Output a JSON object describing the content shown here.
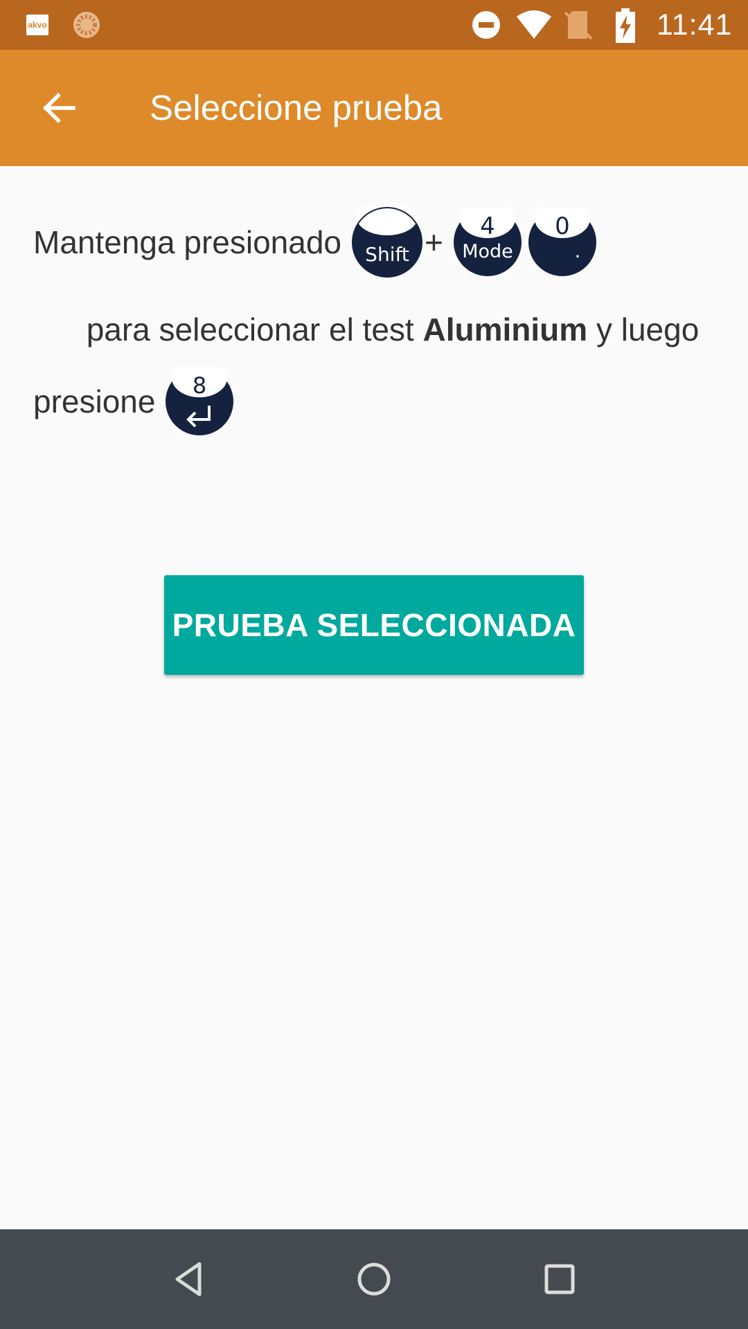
{
  "status_bar": {
    "app_icon_text": "akvo",
    "time": "11:41",
    "icons": [
      "akvo-app-icon",
      "sync-icon",
      "do-not-disturb-icon",
      "wifi-icon",
      "no-sim-icon",
      "battery-charging-icon"
    ]
  },
  "app_bar": {
    "back_icon": "arrow-left-icon",
    "title": "Seleccione prueba",
    "background_color": "#de8a2a"
  },
  "instructions": {
    "line1_text": "Mantenga presionado",
    "plus": "+",
    "line2_before": "para seleccionar el test ",
    "line2_bold": "Aluminium",
    "line2_after": " y luego",
    "line3_text": "presione",
    "keys": {
      "shift": {
        "bottom": "Shift"
      },
      "mode": {
        "top": "4",
        "bottom": "Mode"
      },
      "zero": {
        "top": "0",
        "bottom": "."
      },
      "enter": {
        "top": "8",
        "bottom_icon": "enter-arrow-icon"
      }
    }
  },
  "action": {
    "button_label": "PRUEBA SELECCIONADA",
    "button_color": "#00a99d"
  },
  "nav_bar": {
    "icons": [
      "nav-back-icon",
      "nav-home-icon",
      "nav-recents-icon"
    ]
  }
}
